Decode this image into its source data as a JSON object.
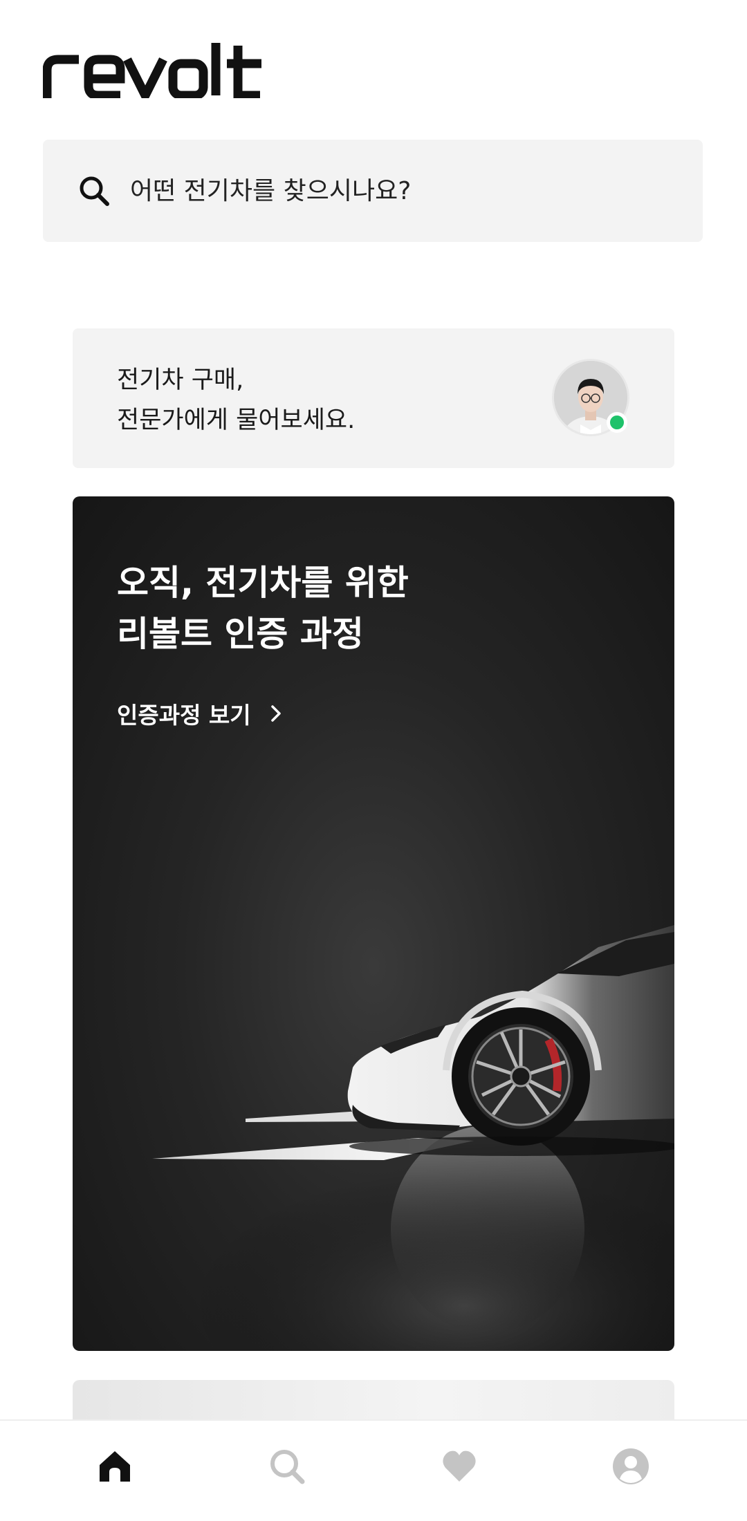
{
  "app": {
    "brand": "revolt"
  },
  "search": {
    "placeholder": "어떤 전기차를 찾으시나요?",
    "icon": "search-icon"
  },
  "expert_card": {
    "line1": "전기차 구매,",
    "line2": "전문가에게 물어보세요.",
    "status": "online",
    "status_color": "#1ec26a"
  },
  "hero": {
    "title_line1": "오직, 전기차를 위한",
    "title_line2": "리볼트 인증 과정",
    "link_label": "인증과정 보기",
    "link_icon": "chevron-right-icon"
  },
  "bottom_nav": {
    "items": [
      {
        "name": "home",
        "icon": "home-icon",
        "active": true
      },
      {
        "name": "search",
        "icon": "search-icon",
        "active": false
      },
      {
        "name": "favorites",
        "icon": "heart-icon",
        "active": false
      },
      {
        "name": "profile",
        "icon": "user-icon",
        "active": false
      }
    ],
    "active_color": "#111111",
    "inactive_color": "#c4c4c4"
  }
}
